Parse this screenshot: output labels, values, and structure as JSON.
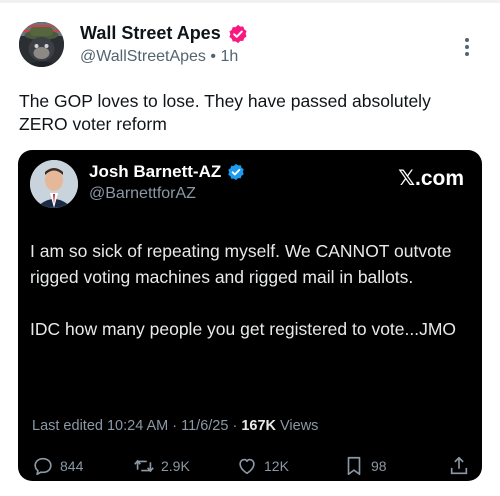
{
  "post": {
    "author_name": "Wall Street Apes",
    "handle": "@WallStreetApes",
    "separator": "•",
    "time": "1h",
    "text": "The GOP loves to lose. They have passed absolutely ZERO voter reform",
    "verified_color": "#f91880",
    "more_icon": "more-vertical-icon"
  },
  "quoted": {
    "author_name": "Josh Barnett-AZ",
    "handle": "@BarnettforAZ",
    "brand": "𝕏.com",
    "verified_color": "#1d9bf0",
    "paragraph_1": "I am so sick of repeating myself.  We CANNOT outvote rigged voting machines and rigged mail in ballots.",
    "paragraph_2": "IDC how many people you get registered to vote...JMO",
    "edited_label": "Last edited 10:24 AM · 11/6/25 ·",
    "views_count": "167K",
    "views_label": "Views",
    "actions": {
      "replies": "844",
      "reposts": "2.9K",
      "likes": "12K",
      "bookmarks": "98"
    }
  }
}
